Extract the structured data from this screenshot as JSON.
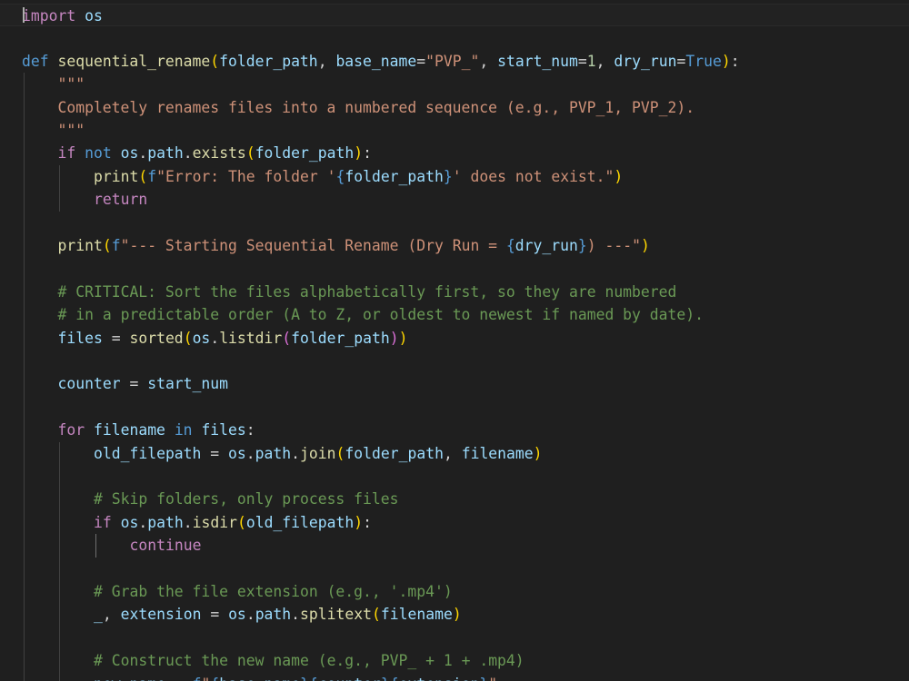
{
  "editor": {
    "language": "python",
    "lines": [
      {
        "text": "import os",
        "current": true
      },
      {
        "text": ""
      },
      {
        "text": "def sequential_rename(folder_path, base_name=\"PVP_\", start_num=1, dry_run=True):"
      },
      {
        "text": "    \"\"\""
      },
      {
        "text": "    Completely renames files into a numbered sequence (e.g., PVP_1, PVP_2)."
      },
      {
        "text": "    \"\"\""
      },
      {
        "text": "    if not os.path.exists(folder_path):"
      },
      {
        "text": "        print(f\"Error: The folder '{folder_path}' does not exist.\")"
      },
      {
        "text": "        return"
      },
      {
        "text": ""
      },
      {
        "text": "    print(f\"--- Starting Sequential Rename (Dry Run = {dry_run}) ---\")"
      },
      {
        "text": ""
      },
      {
        "text": "    # CRITICAL: Sort the files alphabetically first, so they are numbered"
      },
      {
        "text": "    # in a predictable order (A to Z, or oldest to newest if named by date)."
      },
      {
        "text": "    files = sorted(os.listdir(folder_path))"
      },
      {
        "text": ""
      },
      {
        "text": "    counter = start_num"
      },
      {
        "text": ""
      },
      {
        "text": "    for filename in files:"
      },
      {
        "text": "        old_filepath = os.path.join(folder_path, filename)"
      },
      {
        "text": ""
      },
      {
        "text": "        # Skip folders, only process files"
      },
      {
        "text": "        if os.path.isdir(old_filepath):"
      },
      {
        "text": "            continue"
      },
      {
        "text": ""
      },
      {
        "text": "        # Grab the file extension (e.g., '.mp4')"
      },
      {
        "text": "        _, extension = os.path.splitext(filename)"
      },
      {
        "text": ""
      },
      {
        "text": "        # Construct the new name (e.g., PVP_ + 1 + .mp4)"
      },
      {
        "text": "        new_name = f\"{base_name}{counter}{extension}\""
      }
    ]
  }
}
